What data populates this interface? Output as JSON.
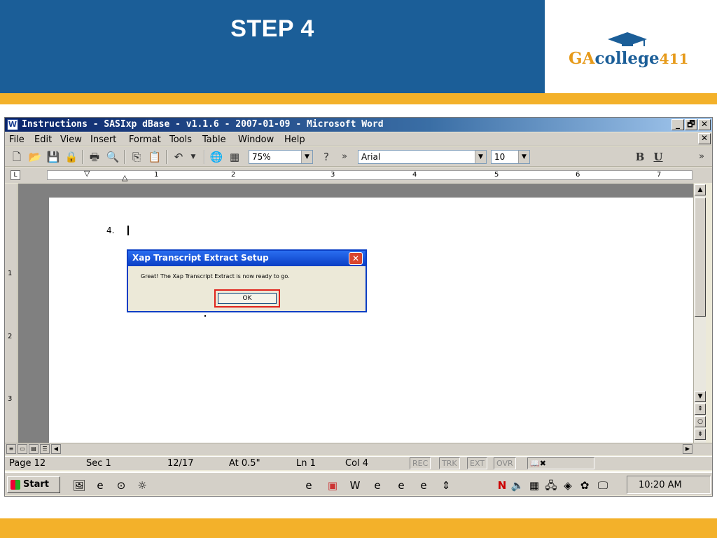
{
  "slide": {
    "title": "STEP 4",
    "logo_text": {
      "ga": "GA",
      "college": "college",
      "num": "411"
    }
  },
  "window": {
    "title": "Instructions - SASIxp dBase - v1.1.6 - 2007-01-09 - Microsoft Word",
    "controls": {
      "minimize": "_",
      "restore": "🗗",
      "close": "✕",
      "doc_close": "✕"
    }
  },
  "menu": [
    "File",
    "Edit",
    "View",
    "Insert",
    "Format",
    "Tools",
    "Table",
    "Window",
    "Help"
  ],
  "toolbar": {
    "zoom": "75%",
    "font": "Arial",
    "font_size": "10",
    "bold": "B",
    "underline": "U",
    "more": "»",
    "icons": [
      "new-doc-icon",
      "open-icon",
      "save-icon",
      "permission-icon",
      "print-icon",
      "print-preview-icon",
      "copy-icon",
      "paste-icon",
      "undo-icon",
      "hyperlink-icon",
      "table-icon",
      "help-icon"
    ]
  },
  "ruler": {
    "numbers": [
      "1",
      "2",
      "3",
      "4",
      "5",
      "6",
      "7"
    ]
  },
  "vruler": {
    "numbers": [
      "1",
      "2",
      "3"
    ]
  },
  "document": {
    "list_number": "4.",
    "dialog": {
      "title": "Xap Transcript Extract Setup",
      "message": "Great! The Xap Transcript Extract is now ready to go.",
      "ok_label": "OK",
      "close": "✕"
    }
  },
  "status": {
    "page": "Page 12",
    "sec": "Sec 1",
    "pages": "12/17",
    "at": "At 0.5\"",
    "ln": "Ln 1",
    "col": "Col 4",
    "rec": "REC",
    "trk": "TRK",
    "ext": "EXT",
    "ovr": "OVR"
  },
  "taskbar": {
    "start_label": "Start",
    "clock": "10:20 AM"
  },
  "colors": {
    "header_blue": "#1b5e98",
    "gold": "#f3b12a",
    "xp_title_blue": "#0a3ec4",
    "ok_highlight": "#e0231b"
  }
}
